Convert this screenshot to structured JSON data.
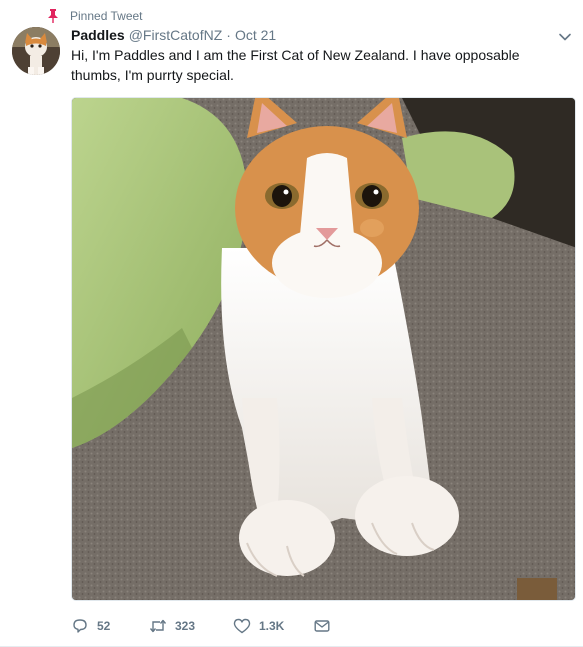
{
  "pinned_label": "Pinned Tweet",
  "tweet": {
    "display_name": "Paddles",
    "handle": "@FirstCatofNZ",
    "separator": "·",
    "timestamp": "Oct 21",
    "text": "Hi, I'm Paddles and I am the First Cat of New Zealand. I have opposable thumbs, I'm purrty special."
  },
  "actions": {
    "replies": "52",
    "retweets": "323",
    "likes": "1.3K"
  },
  "colors": {
    "pin": "#e0245e",
    "muted": "#657786",
    "text": "#14171a",
    "border": "#e6ecf0"
  },
  "icons": {
    "pin": "pin-icon",
    "caret": "chevron-down-icon",
    "reply": "reply-icon",
    "retweet": "retweet-icon",
    "like": "heart-icon",
    "dm": "envelope-icon"
  }
}
